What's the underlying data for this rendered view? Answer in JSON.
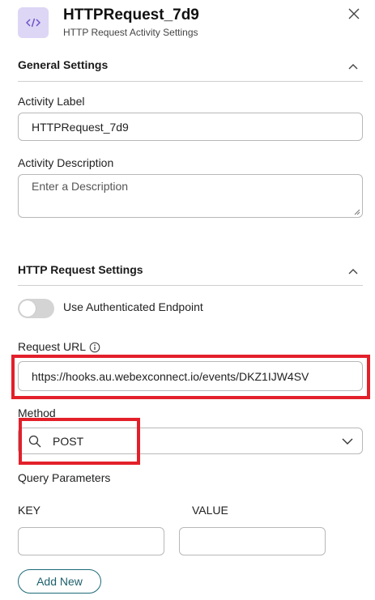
{
  "header": {
    "title": "HTTPRequest_7d9",
    "subtitle": "HTTP Request Activity Settings",
    "icon": "code-icon",
    "icon_color": "#ddd6f5"
  },
  "general_settings": {
    "section_title": "General Settings",
    "activity_label": {
      "label": "Activity Label",
      "value": "HTTPRequest_7d9"
    },
    "activity_description": {
      "label": "Activity Description",
      "placeholder": "Enter a Description",
      "value": ""
    }
  },
  "http_settings": {
    "section_title": "HTTP Request Settings",
    "auth_toggle": {
      "label": "Use Authenticated Endpoint",
      "on": false
    },
    "request_url": {
      "label": "Request URL",
      "value": "https://hooks.au.webexconnect.io/events/DKZ1IJW4SV"
    },
    "method": {
      "label": "Method",
      "value": "POST"
    },
    "query_parameters": {
      "label": "Query Parameters",
      "key_header": "KEY",
      "value_header": "VALUE",
      "key_value": "",
      "value_value": "",
      "add_button": "Add New"
    }
  },
  "colors": {
    "highlight": "#e3202a",
    "button_border": "#1d6a78"
  }
}
